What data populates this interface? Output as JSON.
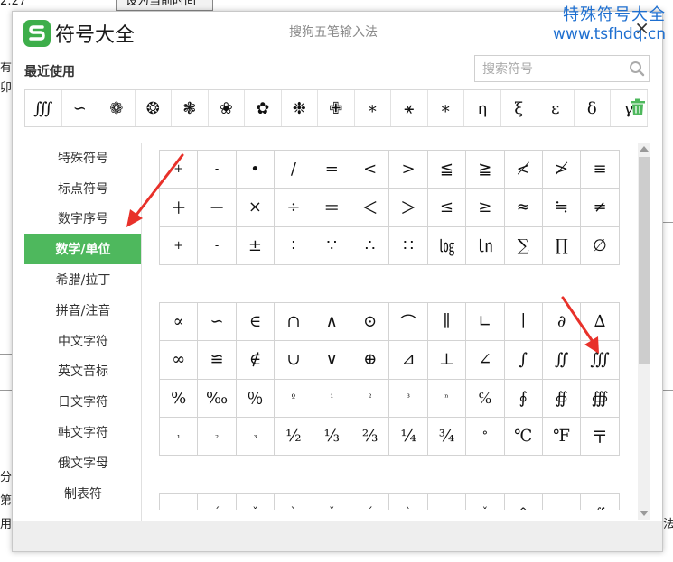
{
  "background": {
    "time_fragment": "2:27",
    "set_time_button": "设为当前时间",
    "left_fragments": [
      "有",
      "卯",
      "分",
      "第",
      "用"
    ],
    "right_fragment": "法"
  },
  "watermark": {
    "line1": "特殊符号大全",
    "line2": "www.tsfhdq.cn"
  },
  "dialog": {
    "app_title": "符号大全",
    "ime_title": "搜狗五笔输入法",
    "close_icon": "×",
    "recent_label": "最近使用",
    "search_placeholder": "搜索符号",
    "recent_symbols": [
      "∭",
      "∽",
      "❁",
      "❂",
      "❃",
      "❀",
      "✿",
      "❉",
      "✙",
      "∗",
      "⚹",
      "∗",
      "η",
      "ξ",
      "ε",
      "δ",
      "γ"
    ],
    "categories": [
      "特殊符号",
      "标点符号",
      "数字序号",
      "数学/单位",
      "希腊/拉丁",
      "拼音/注音",
      "中文字符",
      "英文音标",
      "日文字符",
      "韩文字符",
      "俄文字母",
      "制表符"
    ],
    "active_category": "数学/单位",
    "grid1": [
      [
        "+",
        "-",
        "•",
        "/",
        "=",
        "<",
        ">",
        "≦",
        "≧",
        "≮",
        "≯",
        "≡"
      ],
      [
        "＋",
        "－",
        "×",
        "÷",
        "＝",
        "＜",
        "＞",
        "≤",
        "≥",
        "≈",
        "≒",
        "≠"
      ],
      [
        "+",
        "-",
        "±",
        "∶",
        "∵",
        "∴",
        "∷",
        "㏒",
        "㏑",
        "∑",
        "∏",
        "∅"
      ]
    ],
    "grid2": [
      [
        "∝",
        "∽",
        "∈",
        "∩",
        "∧",
        "⊙",
        "⌒",
        "∥",
        "∟",
        "∣",
        "∂",
        "∆"
      ],
      [
        "∞",
        "≌",
        "∉",
        "∪",
        "∨",
        "⊕",
        "⊿",
        "⊥",
        "∠",
        "∫",
        "∬",
        "∭"
      ],
      [
        "%",
        "‰",
        "％",
        "º",
        "¹",
        "²",
        "³",
        "ⁿ",
        "℅",
        "∮",
        "∯",
        "∰"
      ],
      [
        "₁",
        "₂",
        "₃",
        "½",
        "⅓",
        "⅔",
        "¼",
        "¾",
        "°",
        "℃",
        "℉",
        "〒"
      ]
    ],
    "grid3_partial": [
      "·",
      "ˊ",
      "ˇ",
      "ˋ",
      "ˇ",
      "ˊ",
      "ˋ",
      "·",
      "ˇ",
      "^",
      "⌢",
      "∬"
    ]
  },
  "colors": {
    "active_green": "#4eb85d",
    "logo_green": "#3dae4a",
    "arrow_red": "#e8312a",
    "watermark_blue": "#1e6fd0"
  }
}
